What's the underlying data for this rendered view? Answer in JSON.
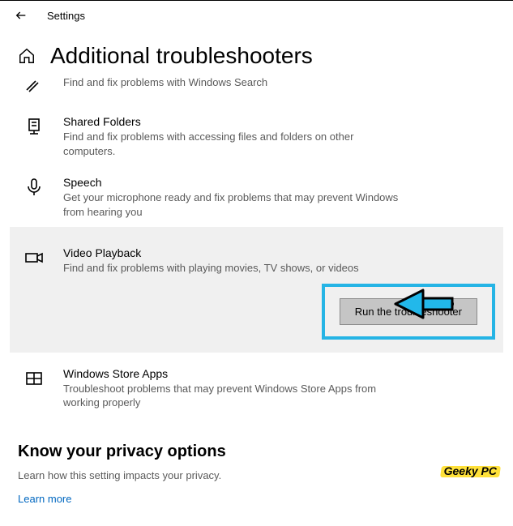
{
  "topbar": {
    "title": "Settings"
  },
  "page_title": "Additional troubleshooters",
  "items": {
    "search": {
      "desc": "Find and fix problems with Windows Search"
    },
    "shared_folders": {
      "title": "Shared Folders",
      "desc": "Find and fix problems with accessing files and folders on other computers."
    },
    "speech": {
      "title": "Speech",
      "desc": "Get your microphone ready and fix problems that may prevent Windows from hearing you"
    },
    "video_playback": {
      "title": "Video Playback",
      "desc": "Find and fix problems with playing movies, TV shows, or videos"
    },
    "store_apps": {
      "title": "Windows Store Apps",
      "desc": "Troubleshoot problems that may prevent Windows Store Apps from working properly"
    }
  },
  "run_button": "Run the troubleshooter",
  "privacy": {
    "title": "Know your privacy options",
    "desc": "Learn how this setting impacts your privacy.",
    "link": "Learn more"
  },
  "watermark": "Geeky PC"
}
